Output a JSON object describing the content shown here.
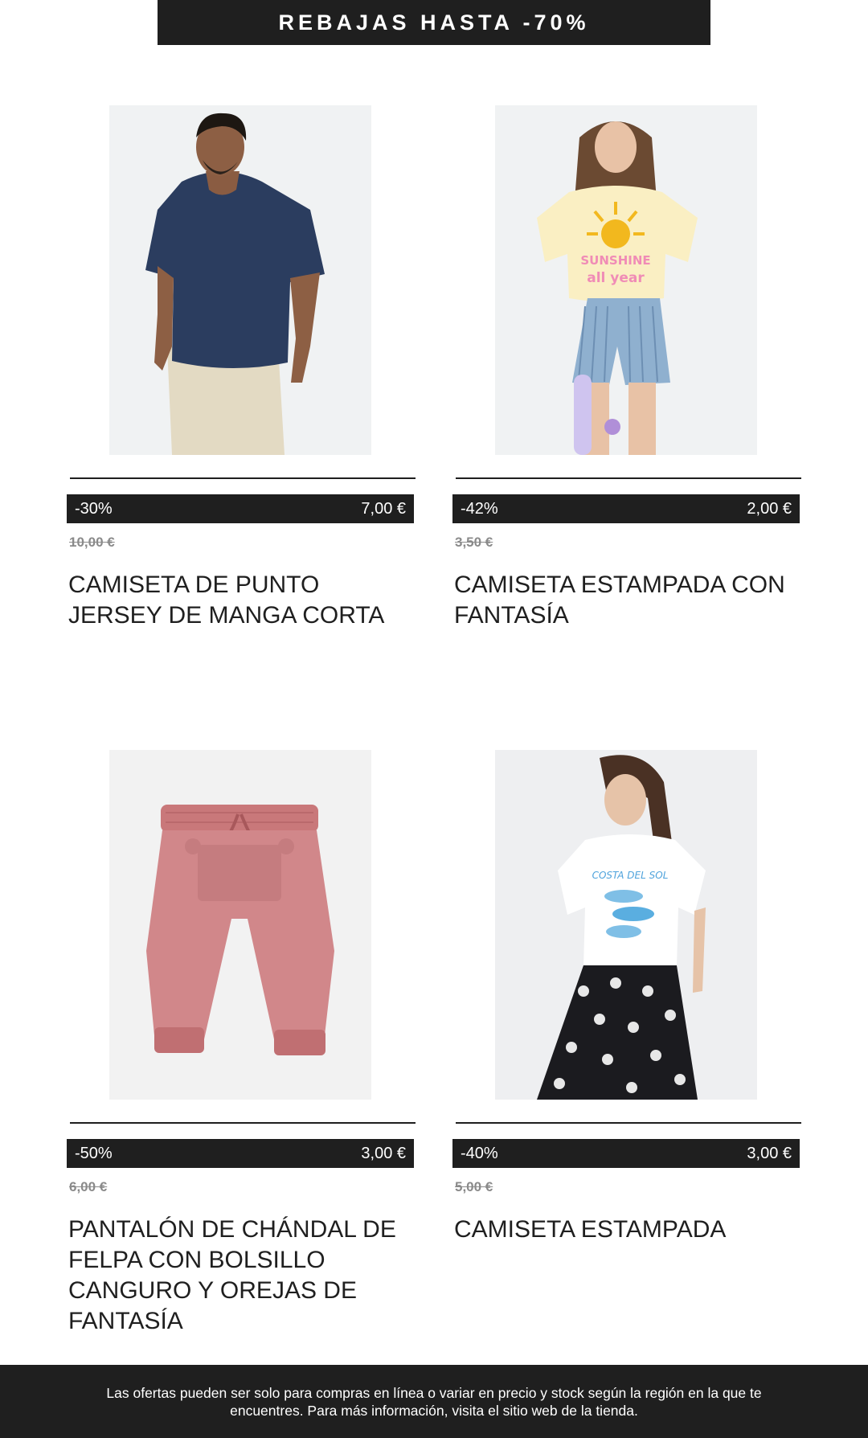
{
  "banner": {
    "text": "REBAJAS HASTA -70%"
  },
  "products": [
    {
      "discount": "-30%",
      "price": "7,00 €",
      "old_price": "10,00 €",
      "name": "CAMISETA DE PUNTO JERSEY DE MANGA CORTA",
      "image_icon": "navy-tshirt-man-photo"
    },
    {
      "discount": "-42%",
      "price": "2,00 €",
      "old_price": "3,50 €",
      "name": "CAMISETA ESTAMPADA CON FANTASÍA",
      "image_icon": "girl-sun-print-tshirt-photo"
    },
    {
      "discount": "-50%",
      "price": "3,00 €",
      "old_price": "6,00 €",
      "name": "PANTALÓN DE CHÁNDAL DE FELPA CON BOLSILLO CANGURO Y OREJAS DE FANTASÍA",
      "image_icon": "pink-jogger-pants-photo"
    },
    {
      "discount": "-40%",
      "price": "3,00 €",
      "old_price": "5,00 €",
      "name": "CAMISETA ESTAMPADA",
      "image_icon": "white-fish-print-tshirt-woman-photo"
    }
  ],
  "footer": {
    "disclaimer": "Las ofertas pueden ser solo para compras en línea o variar en precio y stock según la región en la que te encuentres. Para más información, visita el sitio web de la tienda."
  },
  "colors": {
    "dark": "#1f1f1f",
    "white": "#ffffff",
    "muted": "#8a8a8a",
    "photo_bg": "#f1f3f4"
  }
}
